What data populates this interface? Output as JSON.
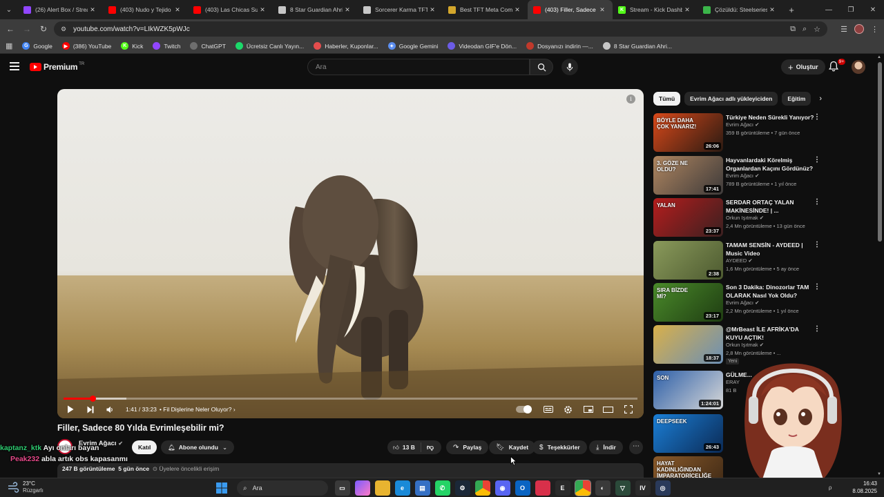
{
  "browser": {
    "tabs": [
      {
        "title": "(26) Alert Box / Stream",
        "color": "#9146ff",
        "letter": "",
        "active": false
      },
      {
        "title": "(403) Nudo y Tejido",
        "color": "#ff0000",
        "letter": "",
        "active": false
      },
      {
        "title": "(403) Las Chicas Super",
        "color": "#ff0000",
        "letter": "",
        "active": false
      },
      {
        "title": "8 Star Guardian Ahri",
        "color": "#c7c7c7",
        "letter": "",
        "active": false
      },
      {
        "title": "Sorcerer Karma TFT",
        "color": "#c7c7c7",
        "letter": "",
        "active": false
      },
      {
        "title": "Best TFT Meta Comps",
        "color": "#d4a72c",
        "letter": "",
        "active": false
      },
      {
        "title": "(403) Filler, Sadece 80",
        "color": "#ff0000",
        "letter": "",
        "active": true
      },
      {
        "title": "Stream - Kick Dashboard",
        "color": "#53fc18",
        "letter": "K",
        "active": false
      },
      {
        "title": "Çözüldü: Steelseries",
        "color": "#3bb54a",
        "letter": "",
        "active": false
      }
    ],
    "url": "youtube.com/watch?v=LIkWZK5pWJc",
    "bookmarks": [
      {
        "label": "Google",
        "color": "#4285f4",
        "letter": "G"
      },
      {
        "label": "(386) YouTube",
        "color": "#ff0000",
        "letter": "▶"
      },
      {
        "label": "Kick",
        "color": "#53fc18",
        "letter": "K"
      },
      {
        "label": "Twitch",
        "color": "#9146ff",
        "letter": ""
      },
      {
        "label": "ChatGPT",
        "color": "#6e6e6e",
        "letter": ""
      },
      {
        "label": "Ücretsiz Canlı Yayın...",
        "color": "#1bd96a",
        "letter": ""
      },
      {
        "label": "Haberler, Kuponlar...",
        "color": "#e44d4d",
        "letter": ""
      },
      {
        "label": "Google Gemini",
        "color": "#5b8def",
        "letter": "✦"
      },
      {
        "label": "Videodan GIF'e Dön...",
        "color": "#6c5ce7",
        "letter": ""
      },
      {
        "label": "Dosyanızı indirin —...",
        "color": "#c0392b",
        "letter": ""
      },
      {
        "label": "8 Star Guardian Ahri...",
        "color": "#c7c7c7",
        "letter": ""
      }
    ]
  },
  "youtube": {
    "logo_text": "Premium",
    "logo_sup": "TR",
    "search_placeholder": "Ara",
    "create_label": "Oluştur",
    "notif_count": "9+"
  },
  "player": {
    "current_time": "1:41",
    "duration": "33:23",
    "time_label": "1:41 / 33:23",
    "chapter": "Fil Dişlerine Neler Oluyor?",
    "played_fraction": 0.05,
    "buffered_fraction": 0.11
  },
  "video": {
    "title": "Filler, Sadece 80 Yılda Evrimleşebilir mi?",
    "channel": "Evrim Ağacı",
    "subscribers": "",
    "join_label": "Katıl",
    "subscribed_label": "Abone olundu",
    "likes": "13 B",
    "share_label": "Paylaş",
    "save_label": "Kaydet",
    "thanks_label": "Teşekkürler",
    "download_label": "İndir",
    "views": "247 B görüntüleme",
    "age": "5 gün önce",
    "members_label": "Üyelere öncelikli erişim"
  },
  "chat": [
    {
      "user": "kaptanz_ktk",
      "message": "Ayı onları bayan"
    },
    {
      "user": "Peak232",
      "message": "abla artık obs kapasanmı"
    }
  ],
  "chips": [
    "Tümü",
    "Evrim Ağacı adlı yükleyiciden",
    "Eğitim"
  ],
  "recommendations": [
    {
      "title": "Türkiye Neden Sürekli Yanıyor?",
      "channel": "Evrim Ağacı",
      "meta": "359 B görüntüleme • 7 gün önce",
      "duration": "26:06",
      "thumb_text": "BÖYLE DAHA ÇOK YANARIZ!",
      "c1": "#d8491a",
      "c2": "#2a1a12"
    },
    {
      "title": "Hayvanlardaki Körelmiş Organlardan Kaçını Gördünüz?",
      "channel": "Evrim Ağacı",
      "meta": "789 B görüntüleme • 1 yıl önce",
      "duration": "17:41",
      "thumb_text": "3. GÖZE NE OLDU?",
      "c1": "#b08660",
      "c2": "#3d3a3a"
    },
    {
      "title": "SERDAR ORTAÇ YALAN MAKİNESİNDE! | ...",
      "channel": "Orkun Işıtmak",
      "meta": "2,4 Mn görüntüleme • 13 gün önce",
      "duration": "23:37",
      "thumb_text": "YALAN",
      "c1": "#b51d1d",
      "c2": "#3a2020"
    },
    {
      "title": "TAMAM SENSİN - AYDEED | Music Video",
      "channel": "AYDEED",
      "meta": "1,6 Mn görüntüleme • 5 ay önce",
      "duration": "2:38",
      "thumb_text": "",
      "c1": "#8a9a5b",
      "c2": "#4d5a30"
    },
    {
      "title": "Son 3 Dakika: Dinozorlar TAM OLARAK Nasıl Yok Oldu?",
      "channel": "Evrim Ağacı",
      "meta": "2,2 Mn görüntüleme • 1 yıl önce",
      "duration": "23:17",
      "thumb_text": "SIRA BİZDE Mİ?",
      "c1": "#4a8a2a",
      "c2": "#1f3d12"
    },
    {
      "title": "@MrBeast İLE AFRİKA'DA KUYU AÇTIK!",
      "channel": "Orkun Işıtmak",
      "meta": "2,8 Mn görüntüleme • ...",
      "badge": "Yeni",
      "duration": "18:37",
      "thumb_text": "",
      "c1": "#d9b04a",
      "c2": "#6b8fb5"
    },
    {
      "title": "GÜLME...",
      "channel": "ERAY",
      "meta": "81 B",
      "duration": "1:24:01",
      "thumb_text": "SON",
      "c1": "#2d5fa8",
      "c2": "#d8d8d8"
    },
    {
      "title": "...",
      "channel": "",
      "meta": "",
      "duration": "26:43",
      "thumb_text": "DEEPSEEK",
      "c1": "#1b7fd6",
      "c2": "#0b2a55"
    },
    {
      "title": "",
      "channel": "",
      "meta": "",
      "duration": "",
      "thumb_text": "HAYAT KADINLIĞINDAN İMPARATORİÇELİĞE",
      "c1": "#8a5a2a",
      "c2": "#3a2614"
    }
  ],
  "taskbar": {
    "temperature": "23°C",
    "condition": "Rüzgarlı",
    "search_label": "Ara",
    "time": "16:43",
    "date": "8.08.2025"
  }
}
